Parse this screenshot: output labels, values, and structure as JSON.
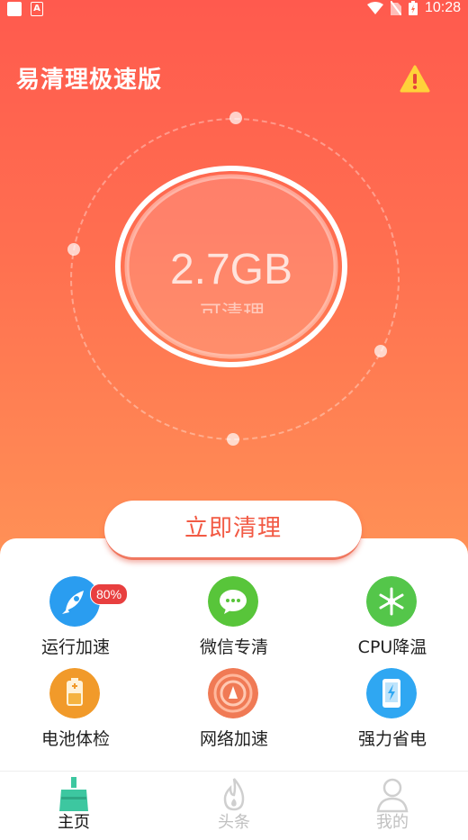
{
  "status_bar": {
    "time": "10:28"
  },
  "header": {
    "title": "易清理极速版",
    "warning_icon": "warning-icon"
  },
  "gauge": {
    "value": "2.7GB",
    "subtitle": "可清理"
  },
  "action": {
    "clean_label": "立即清理"
  },
  "features": [
    {
      "label": "运行加速",
      "icon": "rocket-icon",
      "badge": "80%",
      "color": "#2a9df0"
    },
    {
      "label": "微信专清",
      "icon": "wechat-icon",
      "color": "#58c53a"
    },
    {
      "label": "CPU降温",
      "icon": "snowflake-icon",
      "color": "#54c64a"
    },
    {
      "label": "电池体检",
      "icon": "battery-icon",
      "color": "#f19a2a"
    },
    {
      "label": "网络加速",
      "icon": "network-icon",
      "color": "#f07a55"
    },
    {
      "label": "强力省电",
      "icon": "phone-power-icon",
      "color": "#2fa7f2"
    }
  ],
  "tabs": [
    {
      "label": "主页",
      "icon": "broom-icon",
      "active": true
    },
    {
      "label": "头条",
      "icon": "flame-icon",
      "active": false
    },
    {
      "label": "我的",
      "icon": "person-icon",
      "active": false
    }
  ],
  "colors": {
    "accent": "#ff5a4e",
    "active_tab": "#3dc7a0",
    "inactive_tab": "#c8c8c8"
  }
}
